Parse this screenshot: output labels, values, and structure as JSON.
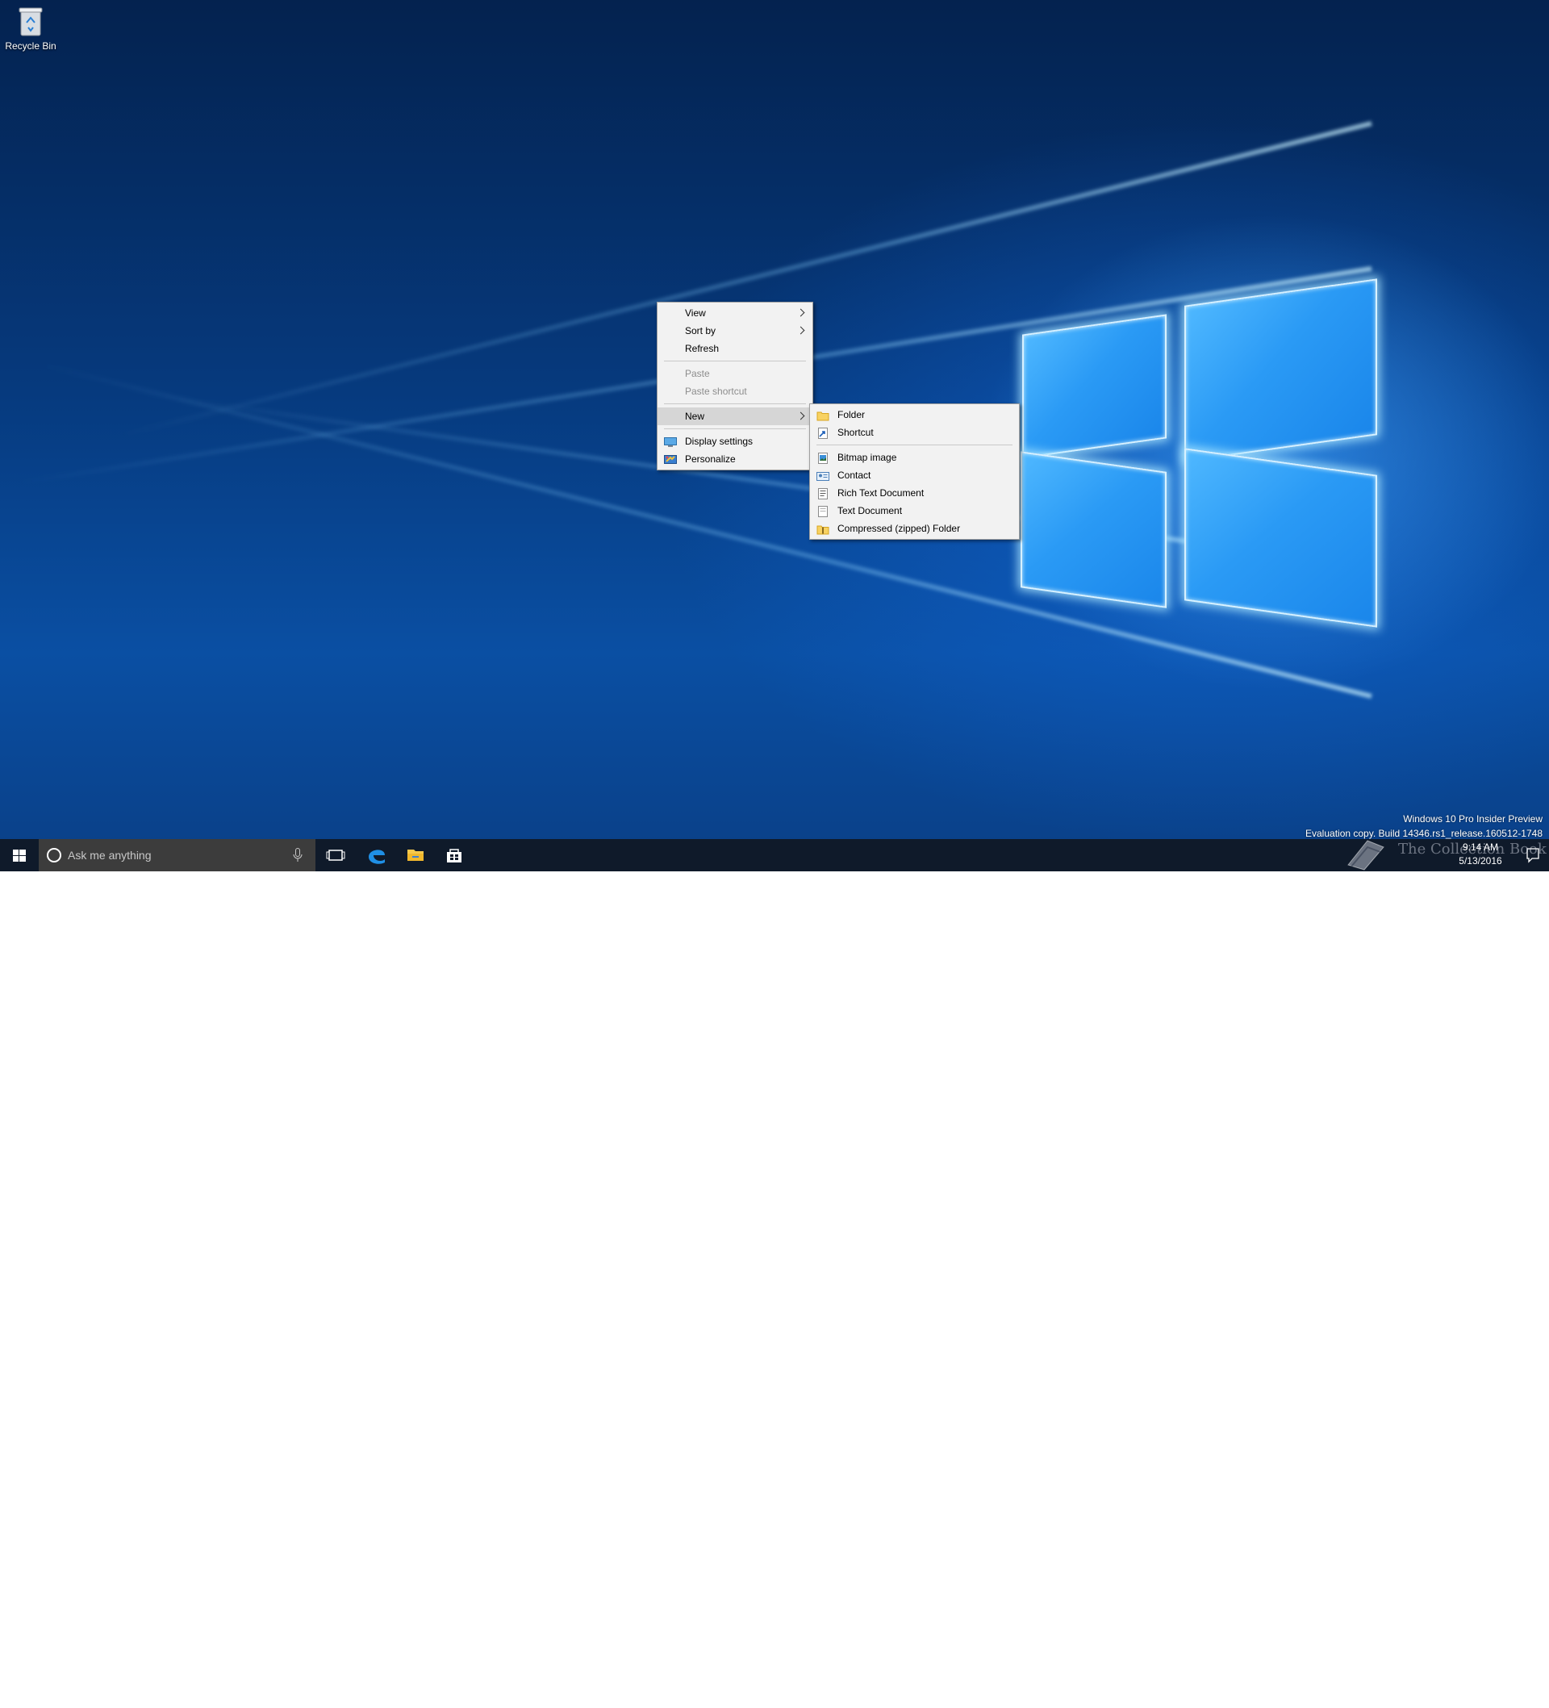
{
  "desktop": {
    "icons": [
      {
        "label": "Recycle Bin"
      }
    ]
  },
  "context_menu": {
    "items": {
      "view": "View",
      "sort_by": "Sort by",
      "refresh": "Refresh",
      "paste": "Paste",
      "paste_shortcut": "Paste shortcut",
      "new": "New",
      "display_settings": "Display settings",
      "personalize": "Personalize"
    }
  },
  "new_submenu": {
    "items": {
      "folder": "Folder",
      "shortcut": "Shortcut",
      "bitmap_image": "Bitmap image",
      "contact": "Contact",
      "rich_text_document": "Rich Text Document",
      "text_document": "Text Document",
      "compressed_folder": "Compressed (zipped) Folder"
    }
  },
  "taskbar": {
    "search_placeholder": "Ask me anything",
    "clock": {
      "time": "9:14 AM",
      "date": "5/13/2016"
    }
  },
  "watermark": {
    "line1": "Windows 10 Pro Insider Preview",
    "line2": "Evaluation copy. Build 14346.rs1_release.160512-1748"
  },
  "overlay_logo": {
    "text": "The Collection Book"
  },
  "colors": {
    "taskbar": "#0f1a2a",
    "search_box": "#3c3c3c",
    "menu_bg": "#f2f2f2",
    "menu_highlight": "#d6d6d6",
    "accent": "#2a9af5"
  }
}
